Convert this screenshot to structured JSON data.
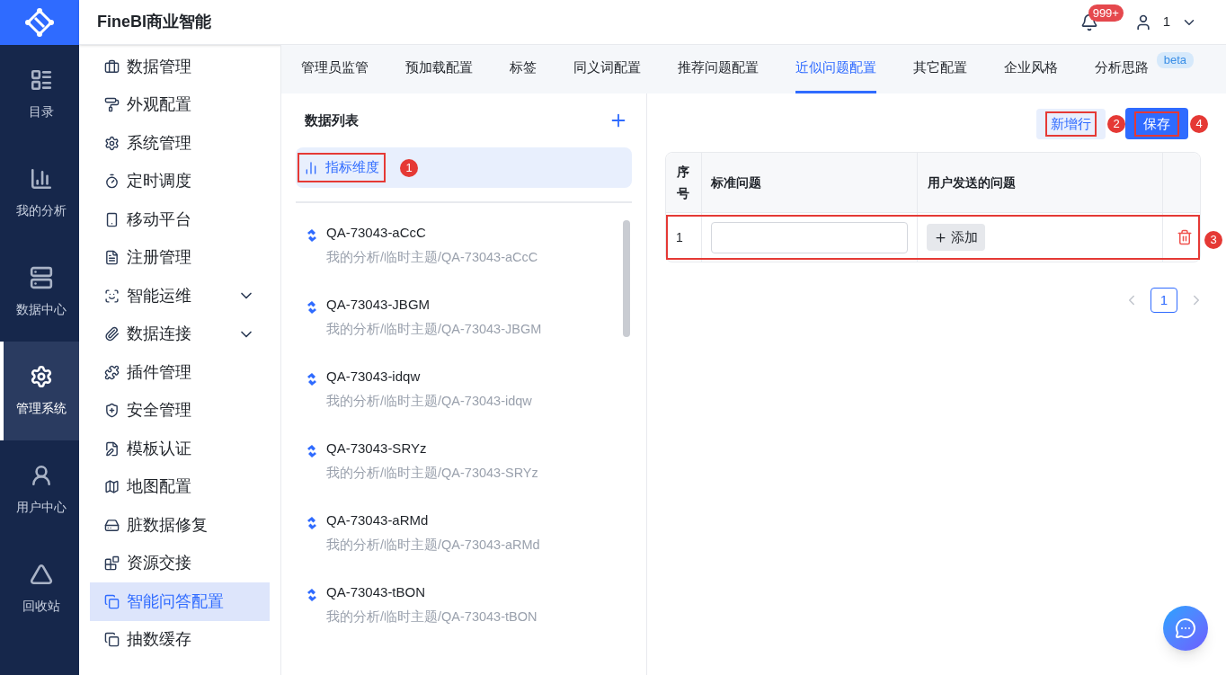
{
  "app": {
    "title": "FineBI商业智能",
    "notifications": "999+",
    "user": "1"
  },
  "nav": [
    {
      "label": "目录",
      "selected": false
    },
    {
      "label": "我的分析",
      "selected": false
    },
    {
      "label": "数据中心",
      "selected": false
    },
    {
      "label": "管理系统",
      "selected": true
    },
    {
      "label": "用户中心",
      "selected": false
    },
    {
      "label": "回收站",
      "selected": false
    }
  ],
  "menu": [
    {
      "label": "数据管理",
      "expandable": false,
      "selected": false
    },
    {
      "label": "外观配置",
      "expandable": false,
      "selected": false
    },
    {
      "label": "系统管理",
      "expandable": false,
      "selected": false
    },
    {
      "label": "定时调度",
      "expandable": false,
      "selected": false
    },
    {
      "label": "移动平台",
      "expandable": false,
      "selected": false
    },
    {
      "label": "注册管理",
      "expandable": false,
      "selected": false
    },
    {
      "label": "智能运维",
      "expandable": true,
      "selected": false
    },
    {
      "label": "数据连接",
      "expandable": true,
      "selected": false
    },
    {
      "label": "插件管理",
      "expandable": false,
      "selected": false
    },
    {
      "label": "安全管理",
      "expandable": false,
      "selected": false
    },
    {
      "label": "模板认证",
      "expandable": false,
      "selected": false
    },
    {
      "label": "地图配置",
      "expandable": false,
      "selected": false
    },
    {
      "label": "脏数据修复",
      "expandable": false,
      "selected": false
    },
    {
      "label": "资源交接",
      "expandable": false,
      "selected": false
    },
    {
      "label": "智能问答配置",
      "expandable": false,
      "selected": true
    },
    {
      "label": "抽数缓存",
      "expandable": false,
      "selected": false
    }
  ],
  "tabs": [
    {
      "label": "管理员监管",
      "selected": false
    },
    {
      "label": "预加载配置",
      "selected": false
    },
    {
      "label": "标签",
      "selected": false
    },
    {
      "label": "同义词配置",
      "selected": false
    },
    {
      "label": "推荐问题配置",
      "selected": false
    },
    {
      "label": "近似问题配置",
      "selected": true
    },
    {
      "label": "其它配置",
      "selected": false
    },
    {
      "label": "企业风格",
      "selected": false
    },
    {
      "label": "分析思路",
      "selected": false,
      "badge": "beta"
    }
  ],
  "list_panel": {
    "title": "数据列表",
    "category": {
      "label": "指标维度",
      "selected": true,
      "callout": "1"
    },
    "items": [
      {
        "name": "QA-73043-aCcC",
        "path": "我的分析/临时主题/QA-73043-aCcC"
      },
      {
        "name": "QA-73043-JBGM",
        "path": "我的分析/临时主题/QA-73043-JBGM"
      },
      {
        "name": "QA-73043-idqw",
        "path": "我的分析/临时主题/QA-73043-idqw"
      },
      {
        "name": "QA-73043-SRYz",
        "path": "我的分析/临时主题/QA-73043-SRYz"
      },
      {
        "name": "QA-73043-aRMd",
        "path": "我的分析/临时主题/QA-73043-aRMd"
      },
      {
        "name": "QA-73043-tBON",
        "path": "我的分析/临时主题/QA-73043-tBON"
      }
    ]
  },
  "toolbar": {
    "add_row": {
      "label": "新增行",
      "callout": "2"
    },
    "save": {
      "label": "保存",
      "callout": "4"
    }
  },
  "table": {
    "columns": [
      "序号",
      "标准问题",
      "用户发送的问题"
    ],
    "rows": [
      {
        "index": "1",
        "add_label": "添加",
        "callout": "3"
      }
    ]
  },
  "pagination": [
    {
      "label": "1",
      "selected": true
    }
  ]
}
